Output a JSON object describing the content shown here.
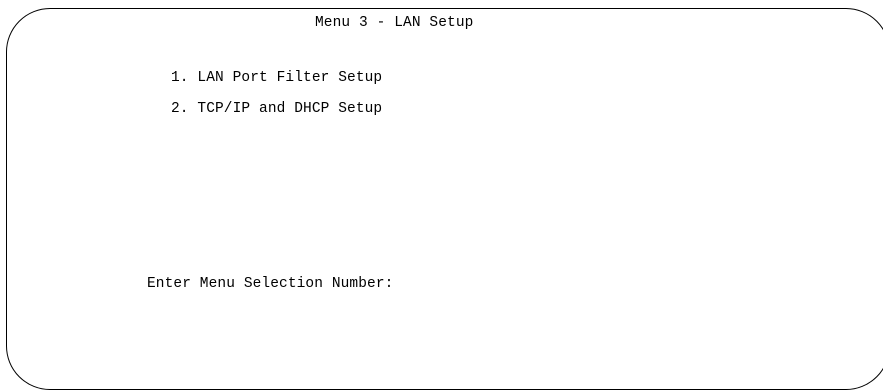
{
  "screen": {
    "title": "Menu 3 - LAN Setup",
    "menu_items": [
      {
        "label": "1. LAN Port Filter Setup"
      },
      {
        "label": "2. TCP/IP and DHCP Setup"
      }
    ],
    "prompt": {
      "label": "Enter Menu Selection Number:",
      "value": ""
    }
  }
}
